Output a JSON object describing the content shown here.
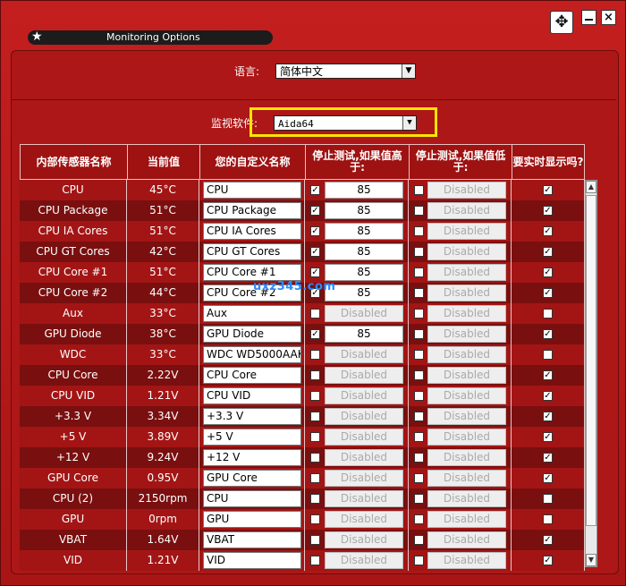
{
  "window": {
    "title": "Monitoring Options",
    "move_icon": "✥",
    "close_icon": "×"
  },
  "settings": {
    "language_label": "语言:",
    "language_value": "简体中文",
    "monitor_label": "监视软件:",
    "monitor_value": "Aida64"
  },
  "table": {
    "headers": [
      "内部传感器名称",
      "当前值",
      "您的自定义名称",
      "停止测试,如果值高于:",
      "停止测试,如果值低于:",
      "要实时显示吗?"
    ],
    "rows": [
      {
        "name": "CPU",
        "value": "45°C",
        "custom": "CPU",
        "hi_on": true,
        "hi": "85",
        "lo_on": false,
        "lo": "Disabled",
        "show": true
      },
      {
        "name": "CPU Package",
        "value": "51°C",
        "custom": "CPU Package",
        "hi_on": true,
        "hi": "85",
        "lo_on": false,
        "lo": "Disabled",
        "show": true
      },
      {
        "name": "CPU IA Cores",
        "value": "51°C",
        "custom": "CPU IA Cores",
        "hi_on": true,
        "hi": "85",
        "lo_on": false,
        "lo": "Disabled",
        "show": true
      },
      {
        "name": "CPU GT Cores",
        "value": "42°C",
        "custom": "CPU GT Cores",
        "hi_on": true,
        "hi": "85",
        "lo_on": false,
        "lo": "Disabled",
        "show": true
      },
      {
        "name": "CPU Core #1",
        "value": "51°C",
        "custom": "CPU Core #1",
        "hi_on": true,
        "hi": "85",
        "lo_on": false,
        "lo": "Disabled",
        "show": true
      },
      {
        "name": "CPU Core #2",
        "value": "44°C",
        "custom": "CPU Core #2",
        "hi_on": true,
        "hi": "85",
        "lo_on": false,
        "lo": "Disabled",
        "show": true
      },
      {
        "name": "Aux",
        "value": "33°C",
        "custom": "Aux",
        "hi_on": false,
        "hi": "Disabled",
        "lo_on": false,
        "lo": "Disabled",
        "show": false
      },
      {
        "name": "GPU Diode",
        "value": "38°C",
        "custom": "GPU Diode",
        "hi_on": true,
        "hi": "85",
        "lo_on": false,
        "lo": "Disabled",
        "show": true
      },
      {
        "name": "WDC",
        "value": "33°C",
        "custom": "WDC WD5000AAK",
        "hi_on": false,
        "hi": "Disabled",
        "lo_on": false,
        "lo": "Disabled",
        "show": false
      },
      {
        "name": "CPU Core",
        "value": "2.22V",
        "custom": "CPU Core",
        "hi_on": false,
        "hi": "Disabled",
        "lo_on": false,
        "lo": "Disabled",
        "show": true
      },
      {
        "name": "CPU VID",
        "value": "1.21V",
        "custom": "CPU VID",
        "hi_on": false,
        "hi": "Disabled",
        "lo_on": false,
        "lo": "Disabled",
        "show": true
      },
      {
        "name": "+3.3 V",
        "value": "3.34V",
        "custom": "+3.3 V",
        "hi_on": false,
        "hi": "Disabled",
        "lo_on": false,
        "lo": "Disabled",
        "show": true
      },
      {
        "name": "+5 V",
        "value": "3.89V",
        "custom": "+5 V",
        "hi_on": false,
        "hi": "Disabled",
        "lo_on": false,
        "lo": "Disabled",
        "show": true
      },
      {
        "name": "+12 V",
        "value": "9.24V",
        "custom": "+12 V",
        "hi_on": false,
        "hi": "Disabled",
        "lo_on": false,
        "lo": "Disabled",
        "show": true
      },
      {
        "name": "GPU Core",
        "value": "0.95V",
        "custom": "GPU Core",
        "hi_on": false,
        "hi": "Disabled",
        "lo_on": false,
        "lo": "Disabled",
        "show": true
      },
      {
        "name": "CPU (2)",
        "value": "2150rpm",
        "custom": "CPU",
        "hi_on": false,
        "hi": "Disabled",
        "lo_on": false,
        "lo": "Disabled",
        "show": false
      },
      {
        "name": "GPU",
        "value": "0rpm",
        "custom": "GPU",
        "hi_on": false,
        "hi": "Disabled",
        "lo_on": false,
        "lo": "Disabled",
        "show": false
      },
      {
        "name": "VBAT",
        "value": "1.64V",
        "custom": "VBAT",
        "hi_on": false,
        "hi": "Disabled",
        "lo_on": false,
        "lo": "Disabled",
        "show": true
      },
      {
        "name": "VID",
        "value": "1.21V",
        "custom": "VID",
        "hi_on": false,
        "hi": "Disabled",
        "lo_on": false,
        "lo": "Disabled",
        "show": true
      }
    ]
  },
  "watermark": "uxz345.com",
  "colors": {
    "highlight": "#f5e600",
    "accent": "#b51a1a"
  }
}
